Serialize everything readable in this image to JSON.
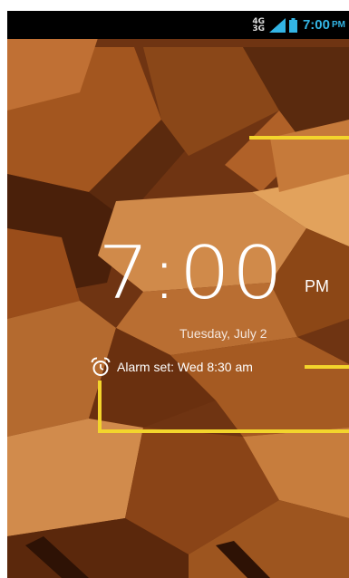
{
  "status_bar": {
    "network_type_top": "4G",
    "network_type_bottom": "3G",
    "time": "7:00",
    "ampm": "PM",
    "accent_color": "#33b5e5"
  },
  "lock_screen": {
    "time": "7:00",
    "ampm": "PM",
    "date": "Tuesday, July 2",
    "alarm_text": "Alarm set: Wed 8:30 am",
    "icons": [
      "signal-icon",
      "battery-icon",
      "alarm-clock-icon"
    ]
  },
  "callouts": {
    "color": "#f3d52c"
  }
}
